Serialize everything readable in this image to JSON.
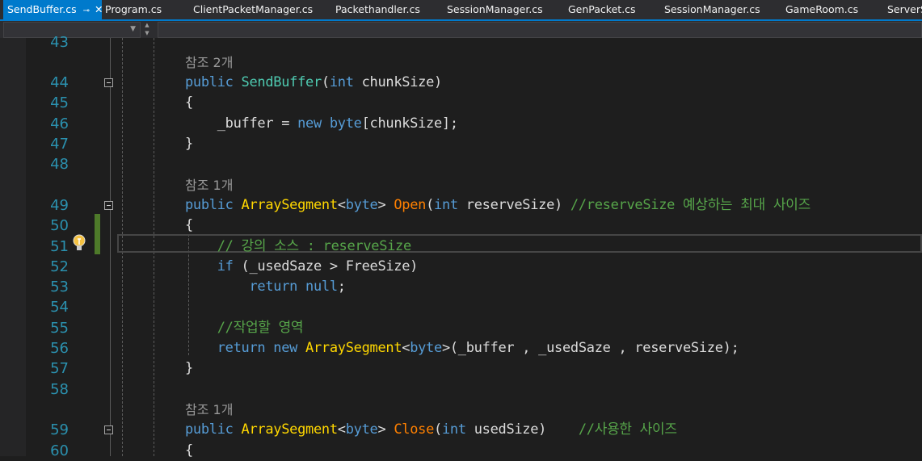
{
  "tabs": [
    {
      "label": "SendBuffer.cs",
      "active": true
    },
    {
      "label": "Program.cs"
    },
    {
      "label": "ClientPacketManager.cs"
    },
    {
      "label": "Packethandler.cs"
    },
    {
      "label": "SessionManager.cs"
    },
    {
      "label": "GenPacket.cs"
    },
    {
      "label": "SessionManager.cs"
    },
    {
      "label": "GameRoom.cs"
    },
    {
      "label": "ServerSe"
    }
  ],
  "tab_pin": "⊸",
  "tab_close": "✕",
  "lines": [
    {
      "n": "43",
      "t": []
    },
    {
      "ref": "참조 2개"
    },
    {
      "n": "44",
      "fold": true,
      "t": [
        [
          "kw",
          "public "
        ],
        [
          "ty",
          "SendBuffer"
        ],
        [
          "tx",
          "("
        ],
        [
          "kw",
          "int "
        ],
        [
          "tx",
          "chunkSize)"
        ]
      ]
    },
    {
      "n": "45",
      "t": [
        [
          "tx",
          "{"
        ]
      ]
    },
    {
      "n": "46",
      "t": [
        [
          "tx",
          "    _buffer = "
        ],
        [
          "kw",
          "new byte"
        ],
        [
          "tx",
          "[chunkSize];"
        ]
      ]
    },
    {
      "n": "47",
      "t": [
        [
          "tx",
          "}"
        ]
      ]
    },
    {
      "n": "48",
      "t": []
    },
    {
      "ref": "참조 1개"
    },
    {
      "n": "49",
      "fold": true,
      "t": [
        [
          "kw",
          "public "
        ],
        [
          "st",
          "ArraySegment"
        ],
        [
          "tx",
          "<"
        ],
        [
          "kw",
          "byte"
        ],
        [
          "tx",
          "> "
        ],
        [
          "fn",
          "Open"
        ],
        [
          "tx",
          "("
        ],
        [
          "kw",
          "int "
        ],
        [
          "tx",
          "reserveSize) "
        ],
        [
          "cm",
          "//reserveSize 예상하는 최대 사이즈"
        ]
      ]
    },
    {
      "n": "50",
      "t": [
        [
          "tx",
          "{"
        ]
      ]
    },
    {
      "n": "51",
      "t": [
        [
          "cm",
          "    // 강의 소스 : reserveSize"
        ]
      ]
    },
    {
      "n": "52",
      "t": [
        [
          "kw",
          "    if "
        ],
        [
          "tx",
          "(_usedSaze > FreeSize)"
        ]
      ]
    },
    {
      "n": "53",
      "t": [
        [
          "kw",
          "        return null"
        ],
        [
          "tx",
          ";"
        ]
      ]
    },
    {
      "n": "54",
      "t": []
    },
    {
      "n": "55",
      "t": [
        [
          "cm",
          "    //작업할 영역"
        ]
      ]
    },
    {
      "n": "56",
      "t": [
        [
          "kw",
          "    return new "
        ],
        [
          "st",
          "ArraySegment"
        ],
        [
          "tx",
          "<"
        ],
        [
          "kw",
          "byte"
        ],
        [
          "tx",
          ">(_buffer , _usedSaze , reserveSize);"
        ]
      ]
    },
    {
      "n": "57",
      "t": [
        [
          "tx",
          "}"
        ]
      ]
    },
    {
      "n": "58",
      "t": []
    },
    {
      "ref": "참조 1개"
    },
    {
      "n": "59",
      "fold": true,
      "t": [
        [
          "kw",
          "public "
        ],
        [
          "st",
          "ArraySegment"
        ],
        [
          "tx",
          "<"
        ],
        [
          "kw",
          "byte"
        ],
        [
          "tx",
          "> "
        ],
        [
          "fn",
          "Close"
        ],
        [
          "tx",
          "("
        ],
        [
          "kw",
          "int "
        ],
        [
          "tx",
          "usedSize)    "
        ],
        [
          "cm",
          "//사용한 사이즈"
        ]
      ]
    },
    {
      "n": "60",
      "t": [
        [
          "tx",
          "{"
        ]
      ]
    }
  ]
}
